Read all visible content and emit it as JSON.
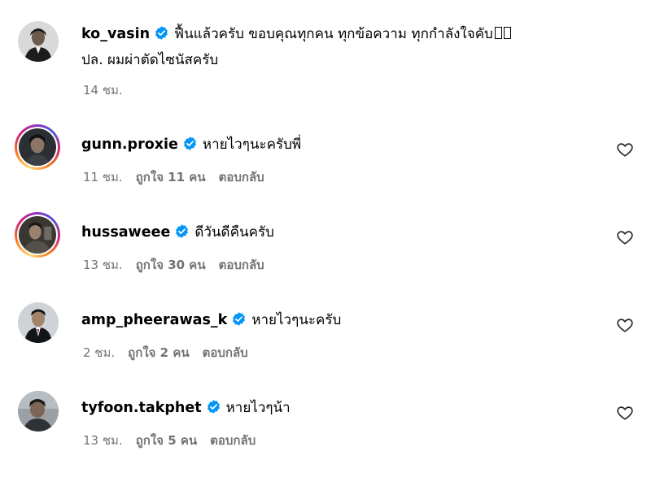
{
  "post": {
    "username": "ko_vasin",
    "text_line1": "ฟื้นแล้วครับ ขอบคุณทุกคน ทุกข้อความ ทุกกำลังใจคับ",
    "text_line2": "ปล. ผมผ่าตัดไซนัสครับ",
    "time": "14 ชม."
  },
  "comments": [
    {
      "username": "gunn.proxie",
      "text": "หายไวๆนะครับพี่",
      "time": "11 ชม.",
      "likes": "ถูกใจ 11 คน",
      "reply": "ตอบกลับ"
    },
    {
      "username": "hussaweee",
      "text": "ดีวันดีคืนครับ",
      "time": "13 ชม.",
      "likes": "ถูกใจ 30 คน",
      "reply": "ตอบกลับ"
    },
    {
      "username": "amp_pheerawas_k",
      "text": "หายไวๆนะครับ",
      "time": "2 ชม.",
      "likes": "ถูกใจ 2 คน",
      "reply": "ตอบกลับ"
    },
    {
      "username": "tyfoon.takphet",
      "text": "หายไวๆน้า",
      "time": "13 ชม.",
      "likes": "ถูกใจ 5 คน",
      "reply": "ตอบกลับ"
    }
  ],
  "icons": {
    "verified": "verified-badge-icon",
    "like": "heart-outline-icon"
  },
  "colors": {
    "verified_blue": "#0095f6",
    "meta_gray": "#737373",
    "text": "#000000"
  }
}
